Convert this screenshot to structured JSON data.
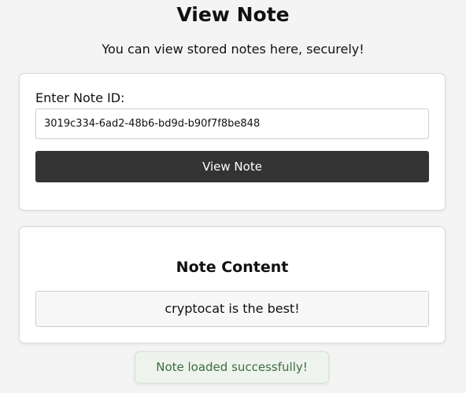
{
  "header": {
    "title": "View Note",
    "subtitle": "You can view stored notes here, securely!"
  },
  "form": {
    "label": "Enter Note ID:",
    "note_id_value": "3019c334-6ad2-48b6-bd9d-b90f7f8be848",
    "button_label": "View Note"
  },
  "note": {
    "heading": "Note Content",
    "content": "cryptocat is the best!"
  },
  "toast": {
    "message": "Note loaded successfully!"
  },
  "colors": {
    "background": "#f4f4f4",
    "button": "#333333",
    "toast_text": "#3c6e3e"
  }
}
